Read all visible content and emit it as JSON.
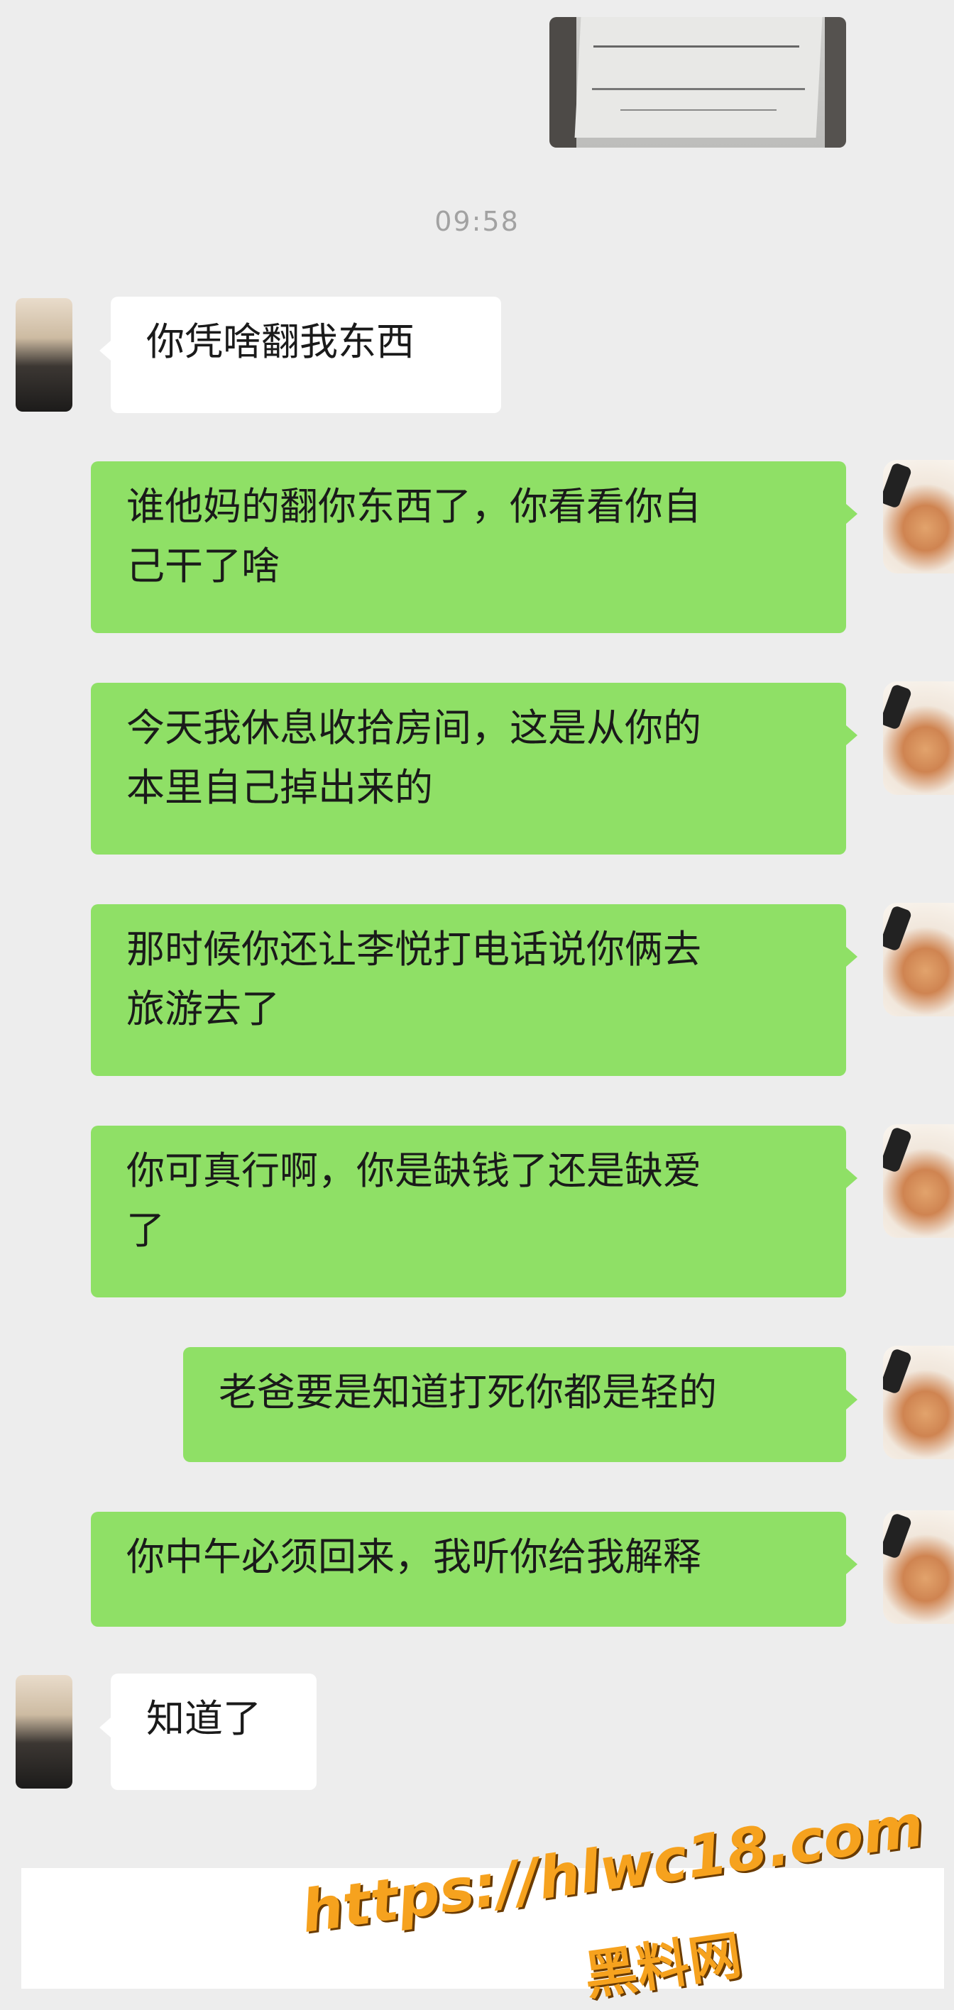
{
  "chat": {
    "timestamp": "09:58",
    "messages": [
      {
        "id": 1,
        "side": "received",
        "text": "你凭啥翻我东西"
      },
      {
        "id": 2,
        "side": "sent",
        "lines": [
          "谁他妈的翻你东西了，你看看你自",
          "己干了啥"
        ]
      },
      {
        "id": 3,
        "side": "sent",
        "lines": [
          "今天我休息收拾房间，这是从你的",
          "本里自己掉出来的"
        ]
      },
      {
        "id": 4,
        "side": "sent",
        "lines": [
          "那时候你还让李悦打电话说你俩去",
          "旅游去了"
        ]
      },
      {
        "id": 5,
        "side": "sent",
        "lines": [
          "你可真行啊，你是缺钱了还是缺爱",
          "了"
        ]
      },
      {
        "id": 6,
        "side": "sent",
        "text": "老爸要是知道打死你都是轻的"
      },
      {
        "id": 7,
        "side": "sent",
        "text": "你中午必须回来，我听你给我解释"
      },
      {
        "id": 8,
        "side": "received",
        "text": "知道了"
      }
    ]
  },
  "watermark": {
    "url": "https://hlwc18.com",
    "name": "黑料网"
  },
  "colors": {
    "background": "#ededed",
    "sent_bubble": "#8fe066",
    "received_bubble": "#ffffff",
    "timestamp": "#a2a2a2",
    "watermark": "#f6a21e"
  }
}
